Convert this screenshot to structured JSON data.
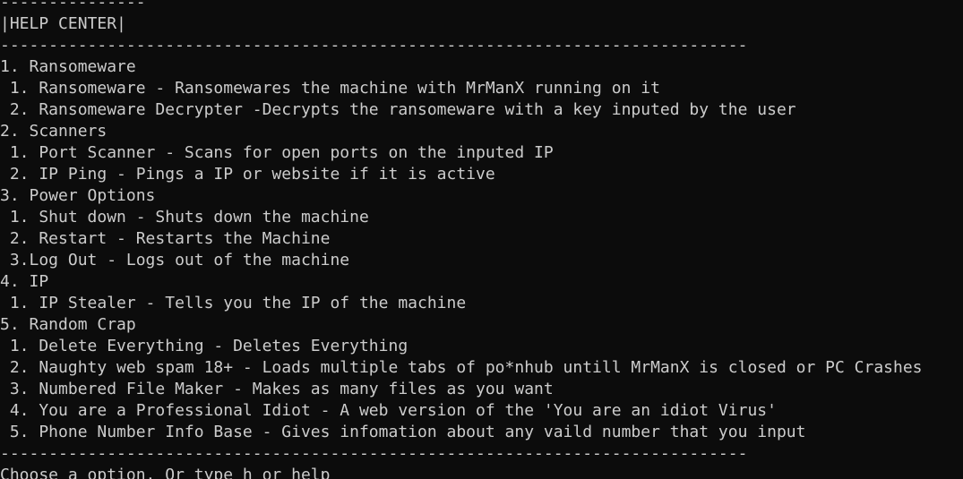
{
  "terminal": {
    "lines": [
      {
        "kind": "separator",
        "text": "---------------"
      },
      {
        "kind": "title",
        "text": "|HELP CENTER|"
      },
      {
        "kind": "separator",
        "text": "-----------------------------------------------------------------------------"
      },
      {
        "kind": "category",
        "text": "1. Ransomeware"
      },
      {
        "kind": "option",
        "text": " 1. Ransomeware - Ransomewares the machine with MrManX running on it"
      },
      {
        "kind": "option",
        "text": " 2. Ransomeware Decrypter -Decrypts the ransomeware with a key inputed by the user"
      },
      {
        "kind": "category",
        "text": "2. Scanners"
      },
      {
        "kind": "option",
        "text": " 1. Port Scanner - Scans for open ports on the inputed IP"
      },
      {
        "kind": "option",
        "text": " 2. IP Ping - Pings a IP or website if it is active"
      },
      {
        "kind": "category",
        "text": "3. Power Options"
      },
      {
        "kind": "option",
        "text": " 1. Shut down - Shuts down the machine"
      },
      {
        "kind": "option",
        "text": " 2. Restart - Restarts the Machine"
      },
      {
        "kind": "option",
        "text": " 3.Log Out - Logs out of the machine"
      },
      {
        "kind": "category",
        "text": "4. IP"
      },
      {
        "kind": "option",
        "text": " 1. IP Stealer - Tells you the IP of the machine"
      },
      {
        "kind": "category",
        "text": "5. Random Crap"
      },
      {
        "kind": "option",
        "text": " 1. Delete Everything - Deletes Everything"
      },
      {
        "kind": "option",
        "text": " 2. Naughty web spam 18+ - Loads multiple tabs of po*nhub untill MrManX is closed or PC Crashes"
      },
      {
        "kind": "option",
        "text": " 3. Numbered File Maker - Makes as many files as you want"
      },
      {
        "kind": "option",
        "text": " 4. You are a Professional Idiot - A web version of the 'You are an idiot Virus'"
      },
      {
        "kind": "option",
        "text": " 5. Phone Number Info Base - Gives infomation about any vaild number that you input"
      },
      {
        "kind": "separator",
        "text": "-----------------------------------------------------------------------------"
      },
      {
        "kind": "prompt",
        "text": "Choose a option. Or type h or help"
      }
    ]
  },
  "colors": {
    "background": "#0c0c0c",
    "text": "#cccccc"
  }
}
